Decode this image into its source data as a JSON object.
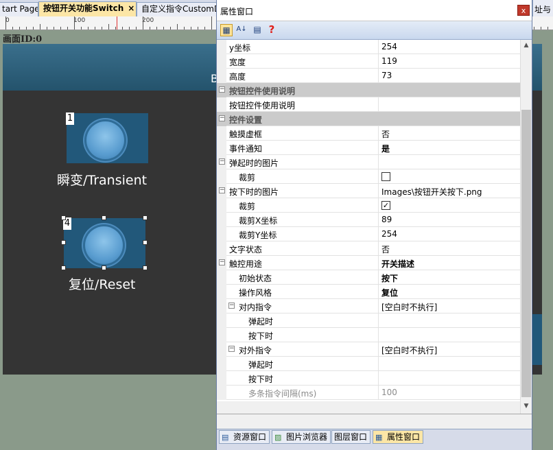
{
  "doc_tabs": [
    {
      "label": "tart Page",
      "active": false
    },
    {
      "label": "按钮开关功能Switch",
      "active": true,
      "close": "×"
    },
    {
      "label": "自定义指令CustomD",
      "active": false
    }
  ],
  "right_edge_text": "址与",
  "ruler": {
    "labels": [
      "0",
      "100",
      "200"
    ]
  },
  "canvas": {
    "screen_label": "画面ID:0",
    "header_text": "B",
    "widgets": [
      {
        "id": "1",
        "caption": "瞬变/Transient",
        "selected": false
      },
      {
        "id": "4",
        "caption": "复位/Reset",
        "selected": true
      }
    ]
  },
  "property_window": {
    "title": "属性窗口",
    "close_glyph": "x",
    "toolbar": {
      "categorized": "▦",
      "alphabetical": "A↓",
      "pages": "▤",
      "help": "?"
    },
    "rows": [
      {
        "name": "y坐标",
        "value": "254",
        "indent": 0
      },
      {
        "name": "宽度",
        "value": "119",
        "indent": 0
      },
      {
        "name": "高度",
        "value": "73",
        "indent": 0
      },
      {
        "name": "按钮控件使用说明",
        "category": true,
        "expander": "−"
      },
      {
        "name": "按钮控件使用说明",
        "value": "",
        "indent": 0
      },
      {
        "name": "控件设置",
        "category": true,
        "expander": "−"
      },
      {
        "name": "触摸虚框",
        "value": "否",
        "indent": 0
      },
      {
        "name": "事件通知",
        "value": "是",
        "indent": 0,
        "bold": true
      },
      {
        "name": "弹起时的图片",
        "value": "",
        "indent": 0,
        "expander": "−"
      },
      {
        "name": "裁剪",
        "value": "",
        "indent": 1,
        "checkbox": true,
        "checked": false
      },
      {
        "name": "按下时的图片",
        "value": "Images\\按钮开关按下.png",
        "indent": 0,
        "expander": "−"
      },
      {
        "name": "裁剪",
        "value": "",
        "indent": 1,
        "checkbox": true,
        "checked": true
      },
      {
        "name": "裁剪X坐标",
        "value": "89",
        "indent": 1
      },
      {
        "name": "裁剪Y坐标",
        "value": "254",
        "indent": 1
      },
      {
        "name": "文字状态",
        "value": "否",
        "indent": 0
      },
      {
        "name": "触控用途",
        "value": "开关描述",
        "indent": 0,
        "bold": true,
        "expander": "−"
      },
      {
        "name": "初始状态",
        "value": "按下",
        "indent": 1,
        "bold": true
      },
      {
        "name": "操作风格",
        "value": "复位",
        "indent": 1,
        "bold": true
      },
      {
        "name": "对内指令",
        "value": "[空白时不执行]",
        "indent": 1,
        "expander": "−"
      },
      {
        "name": "弹起时",
        "value": "",
        "indent": 2
      },
      {
        "name": "按下时",
        "value": "",
        "indent": 2
      },
      {
        "name": "对外指令",
        "value": "[空白时不执行]",
        "indent": 1,
        "expander": "−"
      },
      {
        "name": "弹起时",
        "value": "",
        "indent": 2
      },
      {
        "name": "按下时",
        "value": "",
        "indent": 2
      },
      {
        "name": "多条指令间隔(ms)",
        "value": "100",
        "indent": 2,
        "grey": true
      }
    ],
    "scroll_up": "▲",
    "scroll_down": "▼"
  },
  "bottom_tabs": [
    {
      "label": "资源窗口",
      "icon": "▤",
      "active": false
    },
    {
      "label": "图片浏览器",
      "icon": "▨",
      "active": false
    },
    {
      "label": "图层窗口",
      "icon": "",
      "active": false
    },
    {
      "label": "属性窗口",
      "icon": "▦",
      "active": true
    }
  ]
}
